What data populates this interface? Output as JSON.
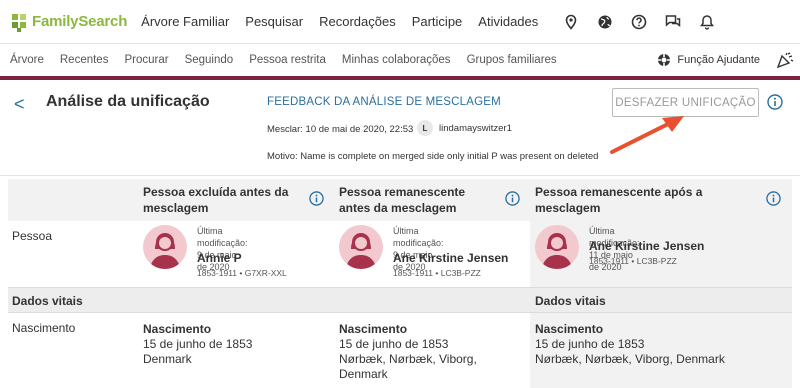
{
  "topnav": {
    "logo_text": "FamilySearch",
    "items": [
      "Árvore Familiar",
      "Pesquisar",
      "Recordações",
      "Participe",
      "Atividades"
    ],
    "icons": [
      "location-icon",
      "globe-icon",
      "help-icon",
      "chat-icon",
      "bell-icon"
    ]
  },
  "subnav": {
    "items": [
      "Árvore",
      "Recentes",
      "Procurar",
      "Seguindo",
      "Pessoa restrita",
      "Minhas colaborações",
      "Grupos familiares"
    ],
    "helper_label": "Função Ajudante"
  },
  "header": {
    "back": "<",
    "title": "Análise da unificação",
    "feedback_link": "FEEDBACK DA ANÁLISE DE MESCLAGEM",
    "undo_button": "DESFAZER UNIFICAÇÃO",
    "merge_date": "Mesclar: 10 de mai de 2020, 22:53",
    "user_initial": "L",
    "user_name": "lindamayswitzer1",
    "reason": "Motivo: Name is complete on merged side only initial P was present on deleted"
  },
  "table": {
    "columns": [
      {
        "title_line1": "Pessoa excluída antes da",
        "title_line2": "mesclagem"
      },
      {
        "title_line1": "Pessoa remanescente",
        "title_line2": "antes da mesclagem"
      },
      {
        "title_line1": "Pessoa remanescente após a",
        "title_line2": "mesclagem"
      }
    ],
    "person_label": "Pessoa",
    "persons": [
      {
        "modified_line1": "Última modificação: 9 de maio",
        "modified_line2": "de 2020",
        "name": "Annie P",
        "meta": "1853-1911 • G7XR-XXL"
      },
      {
        "modified_line1": "Última modificação: 9 de maio",
        "modified_line2": "de 2020",
        "name": "Ane Kirstine Jensen",
        "meta": "1853-1911 • LC3B-PZZ"
      },
      {
        "modified_line1": "Última modificação: 11 de maio de 2020",
        "modified_line2": "",
        "name": "Ane Kirstine Jensen",
        "meta": "1853-1911 • LC3B-PZZ"
      }
    ],
    "vitals_label": "Dados vitais",
    "vitals_label_right": "Dados vitais",
    "birth_label": "Nascimento",
    "births": [
      {
        "title": "Nascimento",
        "date": "15 de junho de 1853",
        "place1": "Denmark",
        "place2": ""
      },
      {
        "title": "Nascimento",
        "date": "15 de junho de 1853",
        "place1": "Nørbæk, Nørbæk, Viborg,",
        "place2": "Denmark"
      },
      {
        "title": "Nascimento",
        "date": "15 de junho de 1853",
        "place1": "Nørbæk, Nørbæk, Viborg, Denmark",
        "place2": ""
      }
    ]
  },
  "colors": {
    "brand_green": "#8cb83e",
    "accent_maroon": "#7a2240",
    "link_blue": "#2a6fa0",
    "arrow_red": "#e8502f",
    "avatar_pink": "#f2c9cf",
    "avatar_dark": "#a8324c"
  }
}
